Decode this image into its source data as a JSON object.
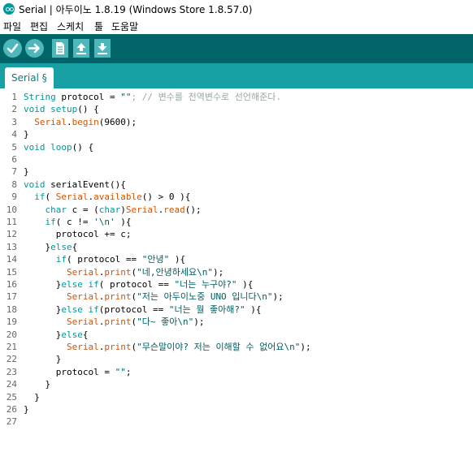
{
  "window": {
    "title": "Serial | 아두이노 1.8.19 (Windows Store 1.8.57.0)"
  },
  "menu": [
    "파일",
    "편집",
    "스케치",
    "툴",
    "도움말"
  ],
  "toolbar": [
    "verify-icon",
    "upload-icon",
    "new-icon",
    "open-icon",
    "save-icon"
  ],
  "tab": {
    "label": "Serial §"
  },
  "lines": [
    [
      {
        "t": "String",
        "c": "kw"
      },
      {
        "t": " protocol = "
      },
      {
        "t": "\"\"",
        "c": "str"
      },
      {
        "t": "; // 변수를 전역변수로 선언해준다.",
        "c": "cmt"
      }
    ],
    [
      {
        "t": "void",
        "c": "kw"
      },
      {
        "t": " "
      },
      {
        "t": "setup",
        "c": "kw"
      },
      {
        "t": "() {"
      }
    ],
    [
      {
        "t": "  "
      },
      {
        "t": "Serial",
        "c": "fn"
      },
      {
        "t": "."
      },
      {
        "t": "begin",
        "c": "fn"
      },
      {
        "t": "(9600);"
      }
    ],
    [
      {
        "t": "}"
      }
    ],
    [
      {
        "t": "void",
        "c": "kw"
      },
      {
        "t": " "
      },
      {
        "t": "loop",
        "c": "kw"
      },
      {
        "t": "() {"
      }
    ],
    [],
    [
      {
        "t": "}"
      }
    ],
    [
      {
        "t": "void",
        "c": "kw"
      },
      {
        "t": " serialEvent(){"
      }
    ],
    [
      {
        "t": "  "
      },
      {
        "t": "if",
        "c": "kw"
      },
      {
        "t": "( "
      },
      {
        "t": "Serial",
        "c": "fn"
      },
      {
        "t": "."
      },
      {
        "t": "available",
        "c": "fn"
      },
      {
        "t": "() > 0 ){"
      }
    ],
    [
      {
        "t": "    "
      },
      {
        "t": "char",
        "c": "kw"
      },
      {
        "t": " c = ("
      },
      {
        "t": "char",
        "c": "kw"
      },
      {
        "t": ")"
      },
      {
        "t": "Serial",
        "c": "fn"
      },
      {
        "t": "."
      },
      {
        "t": "read",
        "c": "fn"
      },
      {
        "t": "();"
      }
    ],
    [
      {
        "t": "    "
      },
      {
        "t": "if",
        "c": "kw"
      },
      {
        "t": "( c != "
      },
      {
        "t": "'\\n'",
        "c": "str"
      },
      {
        "t": " ){"
      }
    ],
    [
      {
        "t": "      protocol += c;"
      }
    ],
    [
      {
        "t": "    }"
      },
      {
        "t": "else",
        "c": "kw"
      },
      {
        "t": "{"
      }
    ],
    [
      {
        "t": "      "
      },
      {
        "t": "if",
        "c": "kw"
      },
      {
        "t": "( protocol == "
      },
      {
        "t": "\"안녕\"",
        "c": "str"
      },
      {
        "t": " ){"
      }
    ],
    [
      {
        "t": "        "
      },
      {
        "t": "Serial",
        "c": "fn"
      },
      {
        "t": "."
      },
      {
        "t": "print",
        "c": "fn"
      },
      {
        "t": "("
      },
      {
        "t": "\"네,안녕하세요\\n\"",
        "c": "str"
      },
      {
        "t": ");"
      }
    ],
    [
      {
        "t": "      }"
      },
      {
        "t": "else",
        "c": "kw"
      },
      {
        "t": " "
      },
      {
        "t": "if",
        "c": "kw"
      },
      {
        "t": "( protocol == "
      },
      {
        "t": "\"너는 누구야?\"",
        "c": "str"
      },
      {
        "t": " ){"
      }
    ],
    [
      {
        "t": "        "
      },
      {
        "t": "Serial",
        "c": "fn"
      },
      {
        "t": "."
      },
      {
        "t": "print",
        "c": "fn"
      },
      {
        "t": "("
      },
      {
        "t": "\"저는 아두이노중 UNO 입니다\\n\"",
        "c": "str"
      },
      {
        "t": ");"
      }
    ],
    [
      {
        "t": "      }"
      },
      {
        "t": "else",
        "c": "kw"
      },
      {
        "t": " "
      },
      {
        "t": "if",
        "c": "kw"
      },
      {
        "t": "(protocol == "
      },
      {
        "t": "\"너는 뭘 좋아해?\"",
        "c": "str"
      },
      {
        "t": " ){"
      }
    ],
    [
      {
        "t": "        "
      },
      {
        "t": "Serial",
        "c": "fn"
      },
      {
        "t": "."
      },
      {
        "t": "print",
        "c": "fn"
      },
      {
        "t": "("
      },
      {
        "t": "\"다~ 좋아\\n\"",
        "c": "str"
      },
      {
        "t": ");"
      }
    ],
    [
      {
        "t": "      }"
      },
      {
        "t": "else",
        "c": "kw"
      },
      {
        "t": "{"
      }
    ],
    [
      {
        "t": "        "
      },
      {
        "t": "Serial",
        "c": "fn"
      },
      {
        "t": "."
      },
      {
        "t": "print",
        "c": "fn"
      },
      {
        "t": "("
      },
      {
        "t": "\"무슨말이야? 저는 이해할 수 없어요\\n\"",
        "c": "str"
      },
      {
        "t": ");"
      }
    ],
    [
      {
        "t": "      }"
      }
    ],
    [
      {
        "t": "      protocol = "
      },
      {
        "t": "\"\"",
        "c": "str"
      },
      {
        "t": ";"
      }
    ],
    [
      {
        "t": "    }"
      }
    ],
    [
      {
        "t": "  }"
      }
    ],
    [
      {
        "t": "}"
      }
    ],
    []
  ]
}
